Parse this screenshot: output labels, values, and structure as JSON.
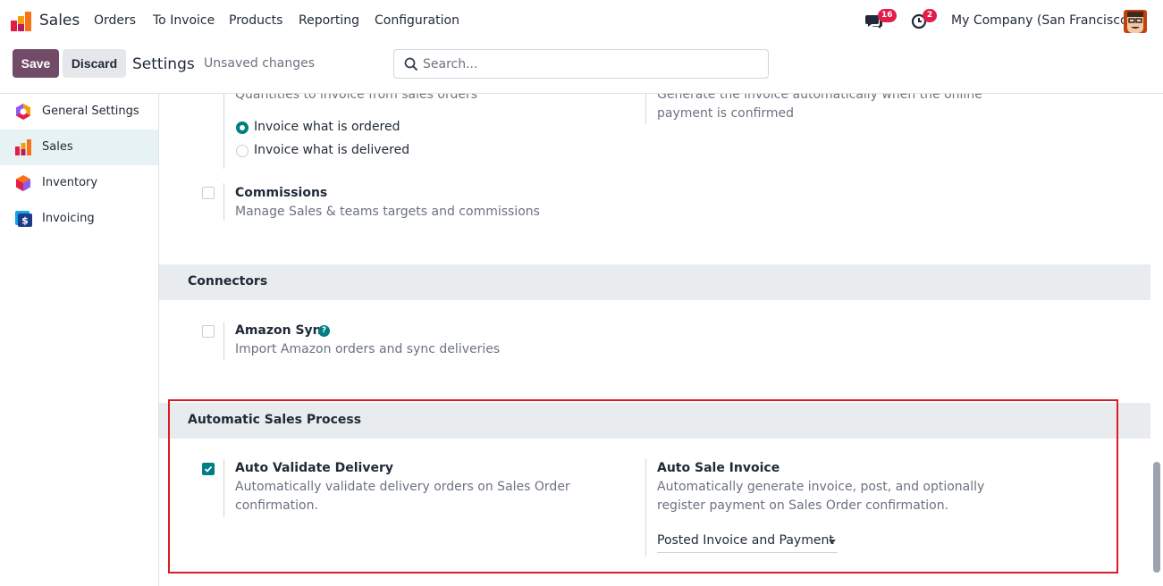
{
  "navbar": {
    "app_name": "Sales",
    "menu": [
      "Orders",
      "To Invoice",
      "Products",
      "Reporting",
      "Configuration"
    ],
    "messages_badge": "16",
    "activities_badge": "2",
    "company": "My Company (San Francisco)"
  },
  "control": {
    "save_label": "Save",
    "discard_label": "Discard",
    "title": "Settings",
    "status": "Unsaved changes",
    "search_placeholder": "Search..."
  },
  "sidebar": {
    "items": [
      {
        "label": "General Settings",
        "icon": "general-settings-icon"
      },
      {
        "label": "Sales",
        "icon": "sales-icon"
      },
      {
        "label": "Inventory",
        "icon": "inventory-icon"
      },
      {
        "label": "Invoicing",
        "icon": "invoicing-icon"
      }
    ]
  },
  "invoicing_policy": {
    "desc": "Quantities to invoice from sales orders",
    "options": [
      "Invoice what is ordered",
      "Invoice what is delivered"
    ],
    "selected": "Invoice what is ordered"
  },
  "online_payment_invoice": {
    "desc": "Generate the invoice automatically when the online payment is confirmed"
  },
  "commissions": {
    "title": "Commissions",
    "desc": "Manage Sales & teams targets and commissions"
  },
  "connectors": {
    "header": "Connectors",
    "amazon": {
      "title": "Amazon Sync",
      "desc": "Import Amazon orders and sync deliveries"
    }
  },
  "auto_process": {
    "header": "Automatic Sales Process",
    "validate": {
      "title": "Auto Validate Delivery",
      "desc": "Automatically validate delivery orders on Sales Order confirmation."
    },
    "invoice": {
      "title": "Auto Sale Invoice",
      "desc": "Automatically generate invoice, post, and optionally register payment on Sales Order confirmation.",
      "select_value": "Posted Invoice and Payment"
    }
  },
  "colors": {
    "brand": "#714b67",
    "teal": "#017e84",
    "highlight": "#dc1c24"
  }
}
